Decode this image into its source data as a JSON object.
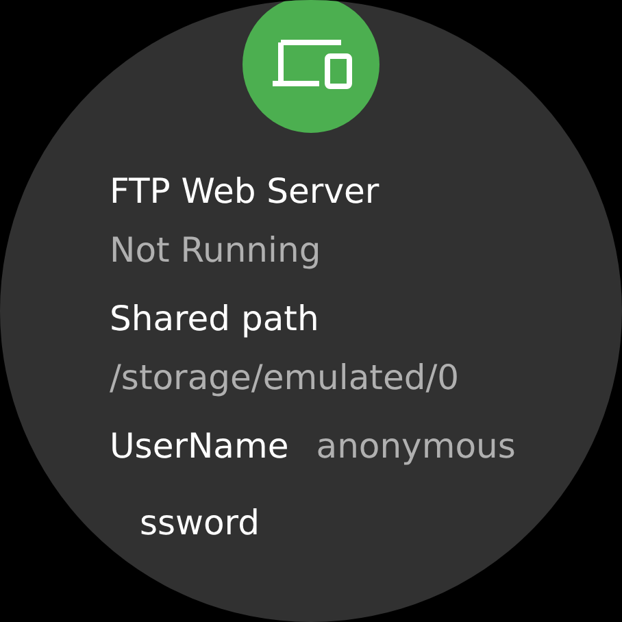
{
  "app_icon": {
    "kind": "devices"
  },
  "items": [
    {
      "kind": "stacked",
      "label": "FTP Web Server",
      "value": "Not Running"
    },
    {
      "kind": "stacked",
      "label": "Shared path",
      "value": "/storage/emulated/0"
    },
    {
      "kind": "inline",
      "label": "UserName",
      "value": "anonymous"
    },
    {
      "kind": "cut",
      "label": "ssword"
    }
  ]
}
